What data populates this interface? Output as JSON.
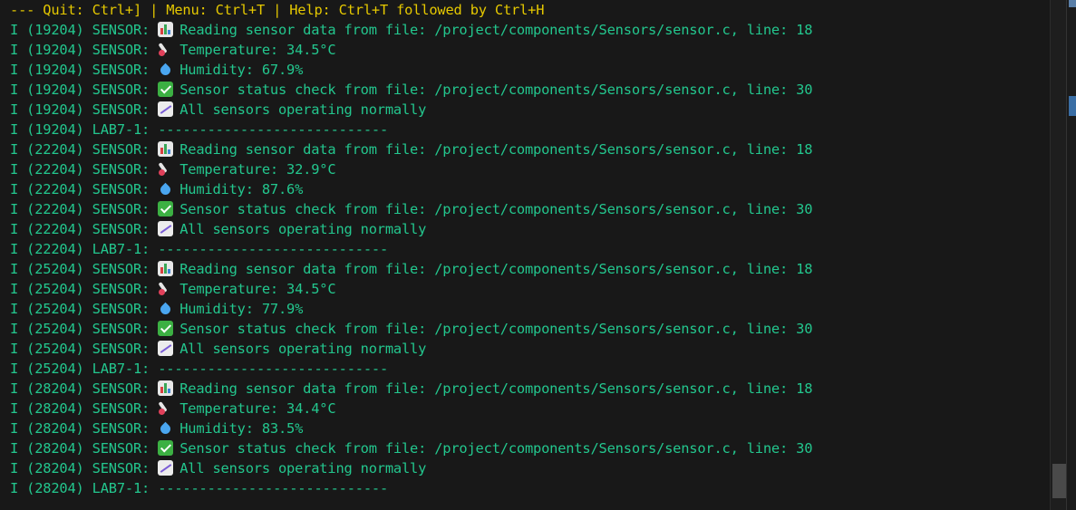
{
  "header": {
    "text": "--- Quit: Ctrl+] | Menu: Ctrl+T | Help: Ctrl+T followed by Ctrl+H"
  },
  "log_lines": [
    {
      "prefix": "I (19204) SENSOR: ",
      "icon": "bar-chart-icon",
      "text": "Reading sensor data from file: /project/components/Sensors/sensor.c, line: 18"
    },
    {
      "prefix": "I (19204) SENSOR: ",
      "icon": "thermometer-icon",
      "text": "Temperature: 34.5°C"
    },
    {
      "prefix": "I (19204) SENSOR: ",
      "icon": "droplet-icon",
      "text": "Humidity: 67.9%"
    },
    {
      "prefix": "I (19204) SENSOR: ",
      "icon": "check-mark-icon",
      "text": "Sensor status check from file: /project/components/Sensors/sensor.c, line: 30"
    },
    {
      "prefix": "I (19204) SENSOR: ",
      "icon": "trend-chart-icon",
      "text": "All sensors operating normally"
    },
    {
      "prefix": "I (19204) LAB7-1: ",
      "icon": "",
      "text": "----------------------------"
    },
    {
      "prefix": "I (22204) SENSOR: ",
      "icon": "bar-chart-icon",
      "text": "Reading sensor data from file: /project/components/Sensors/sensor.c, line: 18"
    },
    {
      "prefix": "I (22204) SENSOR: ",
      "icon": "thermometer-icon",
      "text": "Temperature: 32.9°C"
    },
    {
      "prefix": "I (22204) SENSOR: ",
      "icon": "droplet-icon",
      "text": "Humidity: 87.6%"
    },
    {
      "prefix": "I (22204) SENSOR: ",
      "icon": "check-mark-icon",
      "text": "Sensor status check from file: /project/components/Sensors/sensor.c, line: 30"
    },
    {
      "prefix": "I (22204) SENSOR: ",
      "icon": "trend-chart-icon",
      "text": "All sensors operating normally"
    },
    {
      "prefix": "I (22204) LAB7-1: ",
      "icon": "",
      "text": "----------------------------"
    },
    {
      "prefix": "I (25204) SENSOR: ",
      "icon": "bar-chart-icon",
      "text": "Reading sensor data from file: /project/components/Sensors/sensor.c, line: 18"
    },
    {
      "prefix": "I (25204) SENSOR: ",
      "icon": "thermometer-icon",
      "text": "Temperature: 34.5°C"
    },
    {
      "prefix": "I (25204) SENSOR: ",
      "icon": "droplet-icon",
      "text": "Humidity: 77.9%"
    },
    {
      "prefix": "I (25204) SENSOR: ",
      "icon": "check-mark-icon",
      "text": "Sensor status check from file: /project/components/Sensors/sensor.c, line: 30"
    },
    {
      "prefix": "I (25204) SENSOR: ",
      "icon": "trend-chart-icon",
      "text": "All sensors operating normally"
    },
    {
      "prefix": "I (25204) LAB7-1: ",
      "icon": "",
      "text": "----------------------------"
    },
    {
      "prefix": "I (28204) SENSOR: ",
      "icon": "bar-chart-icon",
      "text": "Reading sensor data from file: /project/components/Sensors/sensor.c, line: 18"
    },
    {
      "prefix": "I (28204) SENSOR: ",
      "icon": "thermometer-icon",
      "text": "Temperature: 34.4°C"
    },
    {
      "prefix": "I (28204) SENSOR: ",
      "icon": "droplet-icon",
      "text": "Humidity: 83.5%"
    },
    {
      "prefix": "I (28204) SENSOR: ",
      "icon": "check-mark-icon",
      "text": "Sensor status check from file: /project/components/Sensors/sensor.c, line: 30"
    },
    {
      "prefix": "I (28204) SENSOR: ",
      "icon": "trend-chart-icon",
      "text": "All sensors operating normally"
    },
    {
      "prefix": "I (28204) LAB7-1: ",
      "icon": "",
      "text": "----------------------------"
    }
  ],
  "colors": {
    "background": "#181818",
    "header_text": "#e5c800",
    "log_text": "#23c78e"
  }
}
